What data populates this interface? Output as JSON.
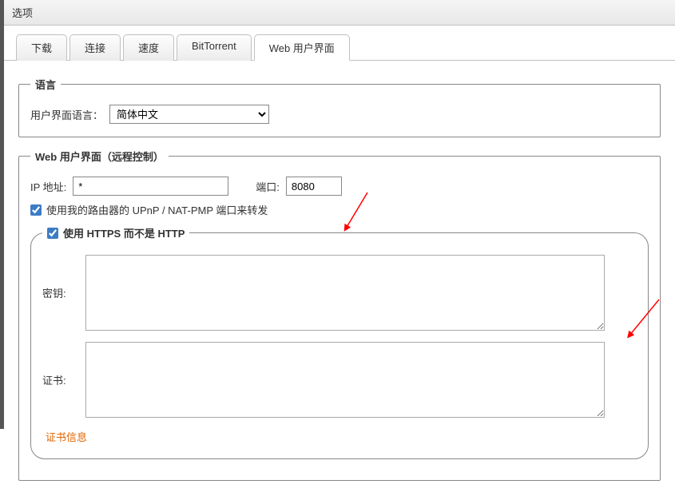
{
  "window": {
    "title": "选项"
  },
  "tabs": {
    "download": "下载",
    "connection": "连接",
    "speed": "速度",
    "bittorrent": "BitTorrent",
    "webui": "Web 用户界面"
  },
  "language": {
    "legend": "语言",
    "label": "用户界面语言：",
    "value": "简体中文"
  },
  "webui_section": {
    "legend": "Web 用户界面（远程控制）",
    "ip_label": "IP 地址:",
    "ip_value": "*",
    "port_label": "端口:",
    "port_value": "8080",
    "upnp_label": "使用我的路由器的 UPnP / NAT-PMP 端口来转发",
    "upnp_checked": true,
    "https": {
      "legend": "使用 HTTPS 而不是 HTTP",
      "checked": true,
      "key_label": "密钥:",
      "key_value": "",
      "cert_label": "证书:",
      "cert_value": "",
      "cert_info": "证书信息"
    }
  }
}
